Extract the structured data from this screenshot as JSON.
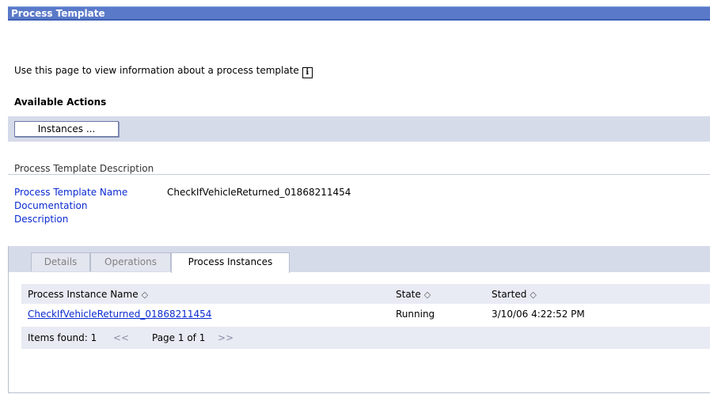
{
  "title": "Process Template",
  "intro": "Use this page to view information about a process template",
  "info_icon": "info-icon",
  "available_actions": "Available Actions",
  "actions": {
    "instances_button": "Instances ..."
  },
  "description_section": {
    "heading": "Process Template Description",
    "fields": [
      {
        "label": "Process Template Name",
        "value": "CheckIfVehicleReturned_01868211454"
      },
      {
        "label": "Documentation",
        "value": ""
      },
      {
        "label": "Description",
        "value": ""
      }
    ]
  },
  "tabs": [
    {
      "label": "Details",
      "active": false
    },
    {
      "label": "Operations",
      "active": false
    },
    {
      "label": "Process Instances",
      "active": true
    }
  ],
  "table": {
    "columns": [
      "Process Instance Name",
      "State",
      "Started"
    ],
    "sort_icon": "◇",
    "rows": [
      {
        "name": "CheckIfVehicleReturned_01868211454",
        "state": "Running",
        "started": "3/10/06 4:22:52 PM"
      }
    ]
  },
  "pagination": {
    "items_found": "Items found: 1",
    "prev": "<<",
    "page": "Page 1 of 1",
    "next": ">>"
  }
}
